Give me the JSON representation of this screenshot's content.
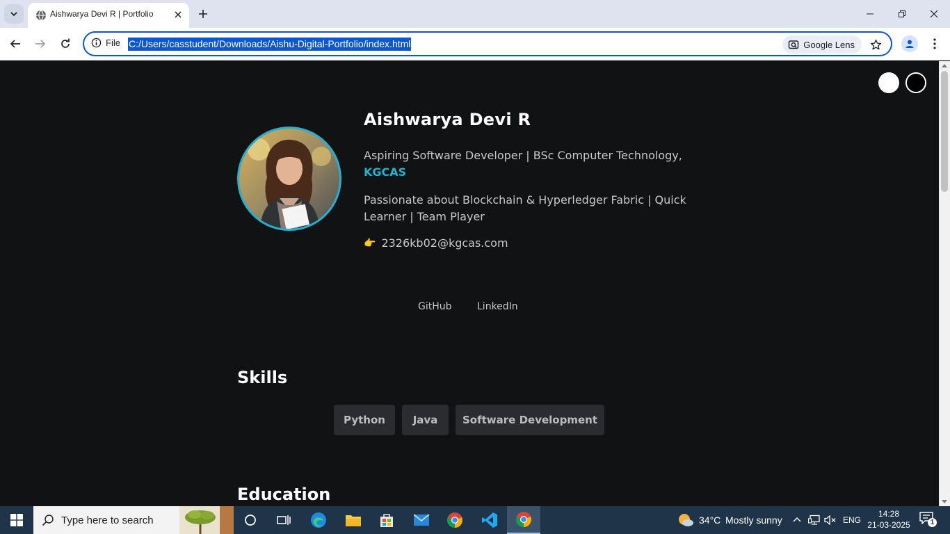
{
  "browser": {
    "tab_title": "Aishwarya Devi R | Portfolio",
    "site_info_label": "File",
    "url": "C:/Users/casstudent/Downloads/Aishu-Digital-Portfolio/index.html",
    "lens_label": "Google Lens"
  },
  "profile": {
    "name": "Aishwarya Devi R",
    "tagline_prefix": "Aspiring Software Developer | BSc Computer Technology,",
    "tagline_link": "KGCAS",
    "passion": "Passionate about Blockchain & Hyperledger Fabric | Quick Learner | Team Player",
    "email_icon": "👉",
    "email": "2326kb02@kgcas.com"
  },
  "social": {
    "github": "GitHub",
    "linkedin": "LinkedIn"
  },
  "skills": {
    "title": "Skills",
    "items": [
      "Python",
      "Java",
      "Software Development"
    ]
  },
  "education": {
    "title": "Education"
  },
  "taskbar": {
    "search_placeholder": "Type here to search",
    "weather_temp": "34°C",
    "weather_desc": "Mostly sunny",
    "language": "ENG",
    "time": "14:28",
    "date": "21-03-2025",
    "notification_count": "1"
  },
  "colors": {
    "accent": "#22b3d3",
    "page_bg": "#111214",
    "chip_bg": "#2b2c2f",
    "browser_focus": "#0b57d0"
  }
}
